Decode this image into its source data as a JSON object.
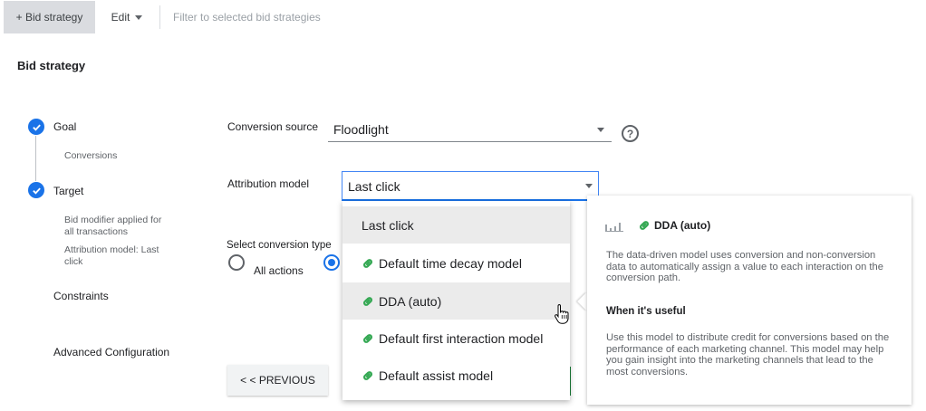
{
  "toolbar": {
    "bid_strategy_button": "+ Bid strategy",
    "edit_button": "Edit",
    "filter_text": "Filter to selected bid strategies"
  },
  "section_title": "Bid strategy",
  "steps": [
    {
      "label": "Goal",
      "completed": true,
      "sub": [
        "Conversions"
      ]
    },
    {
      "label": "Target",
      "completed": true,
      "sub": [
        "Bid modifier applied for all transactions",
        "Attribution model: Last click"
      ]
    },
    {
      "label": "Constraints",
      "completed": false,
      "sub": []
    },
    {
      "label": "Advanced Configuration",
      "completed": false,
      "sub": []
    }
  ],
  "form": {
    "conversion_source_label": "Conversion source",
    "conversion_source_value": "Floodlight",
    "help_icon": "?",
    "attribution_model_label": "Attribution model",
    "attribution_model_value": "Last click",
    "conversion_type_label": "Select conversion type",
    "conversion_type_option_all": "All actions",
    "conversion_type_selected": "second-option"
  },
  "attribution_menu": {
    "items": [
      {
        "label": "Last click",
        "icon": null,
        "highlighted": true
      },
      {
        "label": "Default time decay model",
        "icon": "link-icon",
        "highlighted": false
      },
      {
        "label": "DDA (auto)",
        "icon": "link-icon",
        "highlighted": true
      },
      {
        "label": "Default first interaction model",
        "icon": "link-icon",
        "highlighted": false
      },
      {
        "label": "Default assist model",
        "icon": "link-icon",
        "highlighted": false
      }
    ]
  },
  "tooltip": {
    "title": "DDA (auto)",
    "description": "The data-driven model uses conversion and non-conversion data to automatically assign a value to each interaction on the conversion path.",
    "when_useful_heading": "When it's useful",
    "when_useful_text": "Use this model to distribute credit for conversions based on the performance of each marketing channel. This model may help you gain insight into the marketing channels that lead to the most conversions."
  },
  "buttons": {
    "previous": "< < PREVIOUS"
  },
  "colors": {
    "accent_blue": "#1a73e8",
    "link_green": "#34a853",
    "menu_highlight": "#ebebeb"
  }
}
